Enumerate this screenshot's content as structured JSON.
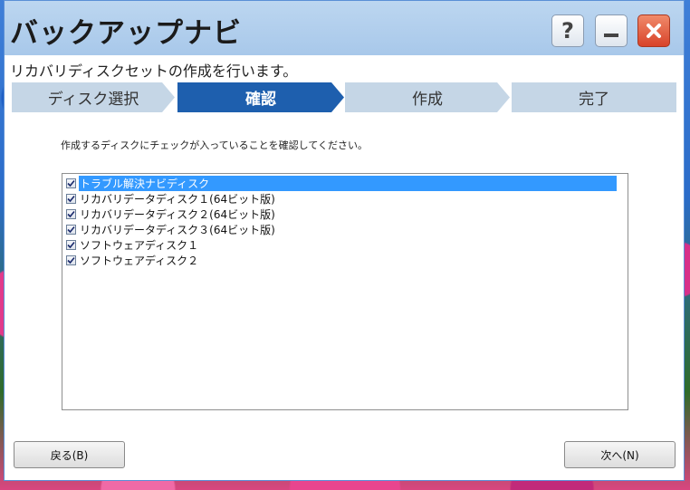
{
  "window": {
    "title": "バックアップナビ",
    "subtitle": "リカバリディスクセットの作成を行います。"
  },
  "title_buttons": {
    "help_icon": "question-icon",
    "minimize_icon": "minimize-icon",
    "close_icon": "close-icon"
  },
  "steps": [
    {
      "label": "ディスク選択",
      "active": false
    },
    {
      "label": "確認",
      "active": true
    },
    {
      "label": "作成",
      "active": false
    },
    {
      "label": "完了",
      "active": false
    }
  ],
  "instruction": "作成するディスクにチェックが入っていることを確認してください。",
  "disks": [
    {
      "label": "トラブル解決ナビディスク",
      "checked": true,
      "selected": true
    },
    {
      "label": "リカバリデータディスク１(64ビット版)",
      "checked": true,
      "selected": false
    },
    {
      "label": "リカバリデータディスク２(64ビット版)",
      "checked": true,
      "selected": false
    },
    {
      "label": "リカバリデータディスク３(64ビット版)",
      "checked": true,
      "selected": false
    },
    {
      "label": "ソフトウェアディスク１",
      "checked": true,
      "selected": false
    },
    {
      "label": "ソフトウェアディスク２",
      "checked": true,
      "selected": false
    }
  ],
  "buttons": {
    "back": "戻る(B)",
    "next": "次へ(N)"
  },
  "colors": {
    "titlebar": "#a8c8ea",
    "step_active": "#1e5fae",
    "step_inactive": "#c5d6e6",
    "selection": "#3399ff",
    "close_button": "#d8432a"
  }
}
